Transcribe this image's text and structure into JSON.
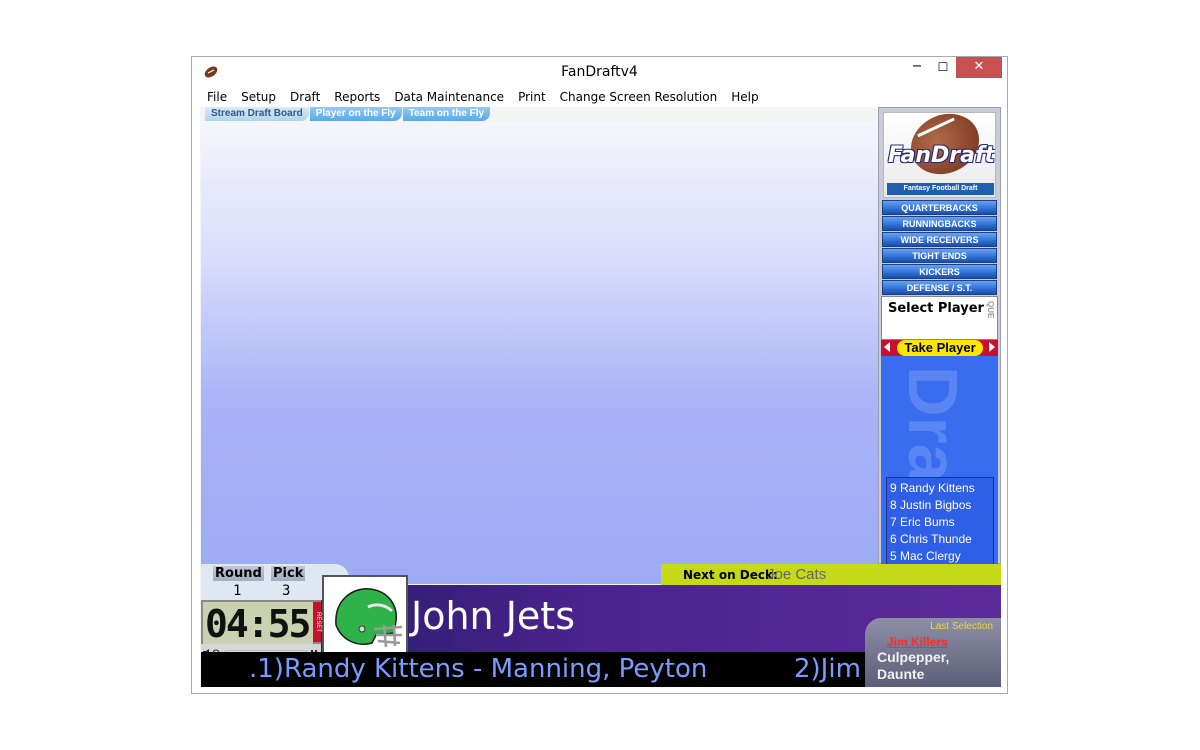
{
  "window": {
    "title": "FanDraftv4",
    "minimize": "−",
    "maximize": "☐",
    "close": "✕"
  },
  "menu": [
    "File",
    "Setup",
    "Draft",
    "Reports",
    "Data Maintenance",
    "Print",
    "Change Screen Resolution",
    "Help"
  ],
  "tabs": [
    {
      "label": "Stream Draft Board",
      "active": true
    },
    {
      "label": "Player on the Fly",
      "active": false
    },
    {
      "label": "Team on the Fly",
      "active": false
    }
  ],
  "logo": {
    "text": "FanDraft",
    "subtitle": "Fantasy Football Draft Assistant"
  },
  "positions": [
    "QUARTERBACKS",
    "RUNNINGBACKS",
    "WIDE RECEIVERS",
    "TIGHT ENDS",
    "KICKERS",
    "DEFENSE / S.T."
  ],
  "select": {
    "label": "Select Player",
    "que": "QUE"
  },
  "take_player": "Take Player",
  "queue_watermark": "Draft",
  "queue": [
    "9 Randy Kittens",
    "8 Justin Bigbos",
    "7 Eric Bums",
    "6 Chris Thunde",
    "5 Mac Clergy"
  ],
  "round_pick": {
    "round_label": "Round",
    "pick_label": "Pick",
    "round": "1",
    "pick": "3"
  },
  "timer": {
    "value": "04:55",
    "reset": "RESET"
  },
  "on_deck": {
    "label": "Next on Deck:",
    "value": "Joe Cats"
  },
  "current_team": "John Jets",
  "helmet_color": "#2fb24a",
  "ticker": {
    "text": ".1)Randy Kittens - Manning, Peyton",
    "next": "2)Jim"
  },
  "last_selection": {
    "header": "Last Selection",
    "team": "Jim Killers",
    "player": "Culpepper, Daunte"
  },
  "colors": {
    "close_button": "#c75050",
    "ondeck_bar": "#c5d918",
    "take_button": "#ffe600",
    "queue_bg": "#3a6cf0"
  }
}
